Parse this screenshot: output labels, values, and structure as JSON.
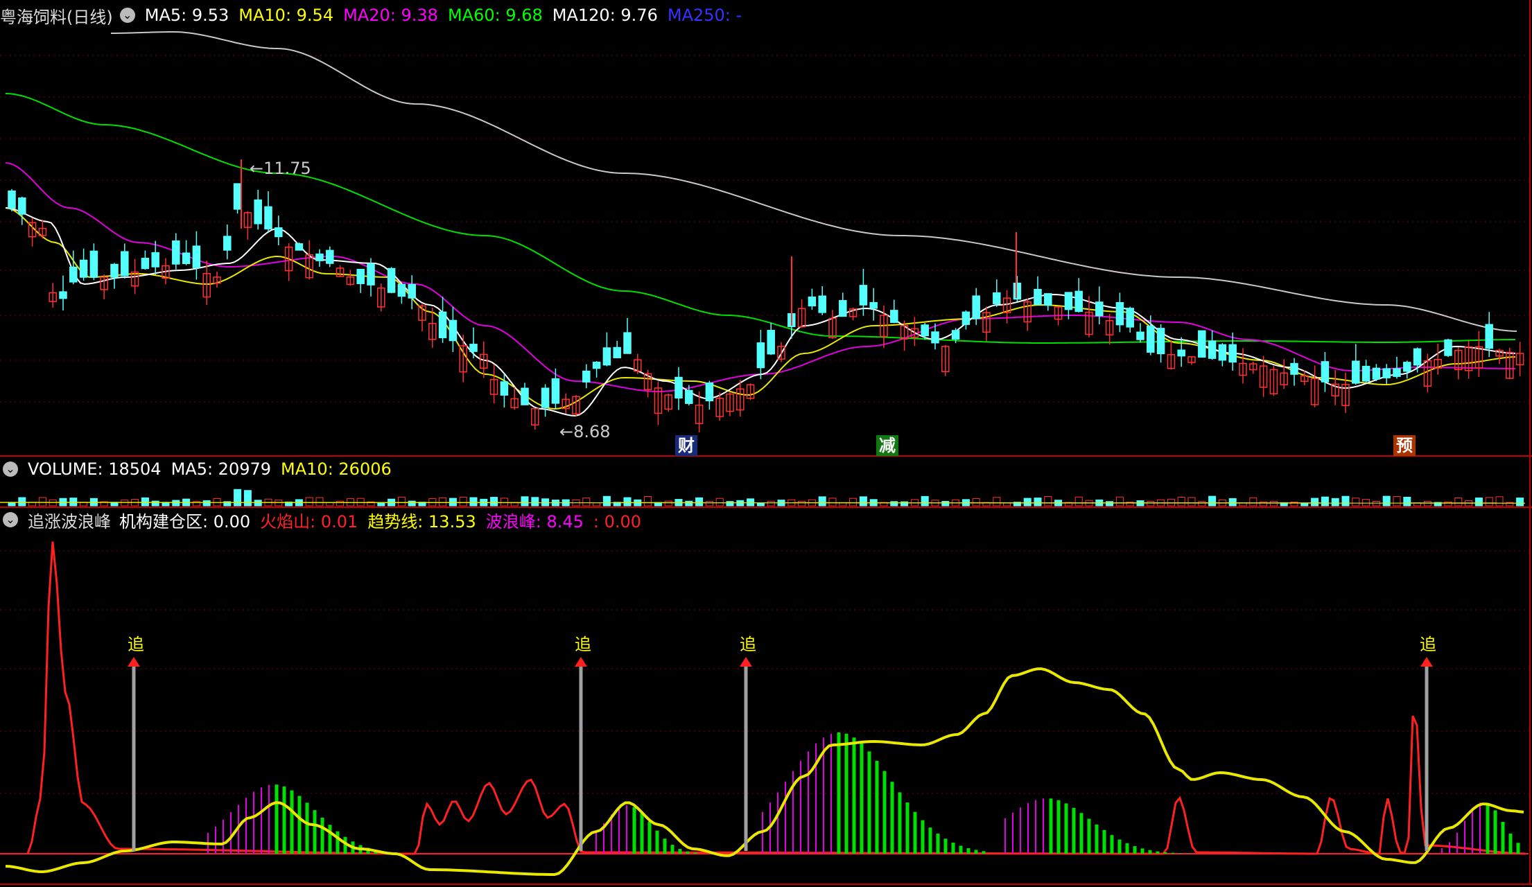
{
  "price_panel": {
    "stock": "粤海饲料(日线)",
    "indicators": [
      {
        "name": "MA5: ",
        "value": "9.53",
        "color": "#ffffff"
      },
      {
        "name": "MA10: ",
        "value": "9.54",
        "color": "#ffff00"
      },
      {
        "name": "MA20: ",
        "value": "9.38",
        "color": "#ff00ff"
      },
      {
        "name": "MA60: ",
        "value": "9.68",
        "color": "#00ff00"
      },
      {
        "name": "MA120: ",
        "value": "9.76",
        "color": "#ffffff"
      },
      {
        "name": "MA250: ",
        "value": "-",
        "color": "#3333ff"
      }
    ],
    "high_label": "11.75",
    "low_label": "8.68",
    "event_tags": [
      {
        "text": "财",
        "color": "#ffffff",
        "bg": "#1a2a7a"
      },
      {
        "text": "减",
        "color": "#ffffff",
        "bg": "#117711"
      },
      {
        "text": "预",
        "color": "#ffffff",
        "bg": "#aa3300"
      }
    ]
  },
  "volume_panel": {
    "indicators": [
      {
        "name": "VOLUME: ",
        "value": "18504",
        "color": "#ffffff"
      },
      {
        "name": "MA5: ",
        "value": "20979",
        "color": "#ffffff"
      },
      {
        "name": "MA10: ",
        "value": "26006",
        "color": "#ffff00"
      }
    ]
  },
  "wave_panel": {
    "title": "追涨波浪峰",
    "indicators": [
      {
        "name": "机构建仓区: ",
        "value": "0.00",
        "color": "#ffffff"
      },
      {
        "name": "火焰山: ",
        "value": "0.01",
        "color": "#ff2222"
      },
      {
        "name": "趋势线: ",
        "value": "13.53",
        "color": "#ffff00"
      },
      {
        "name": "波浪峰: ",
        "value": "8.45",
        "color": "#ff00ff"
      },
      {
        "name": ": ",
        "value": "0.00",
        "color": "#ff2222"
      }
    ],
    "signal_label": "追",
    "signal_count": 4
  },
  "colors": {
    "up": "#ff3030",
    "down": "#54ffff",
    "grid": "#7a0000",
    "separator": "#c00000"
  }
}
